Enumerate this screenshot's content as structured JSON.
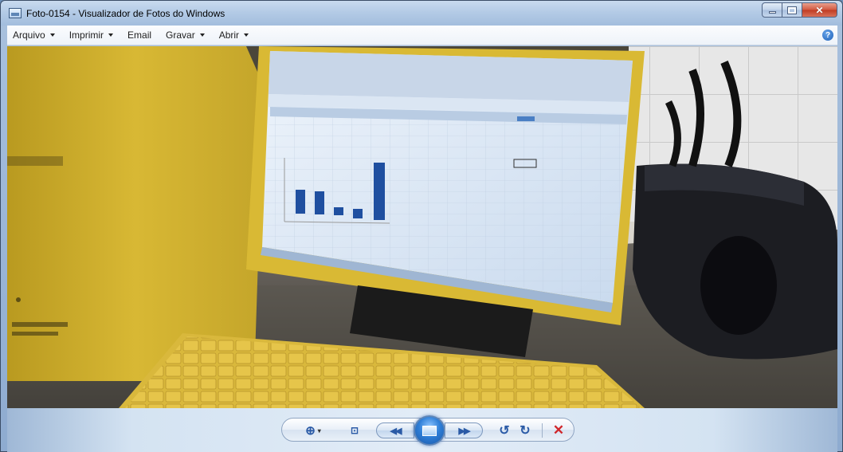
{
  "window": {
    "title": "Foto-0154 - Visualizador de Fotos do Windows",
    "icon": "photo-viewer-icon",
    "controls": {
      "minimize": "minimize-icon",
      "maximize": "maximize-icon",
      "close": "close-icon"
    }
  },
  "menu": {
    "items": [
      {
        "label": "Arquivo",
        "dropdown": true
      },
      {
        "label": "Imprimir",
        "dropdown": true
      },
      {
        "label": "Email",
        "dropdown": false
      },
      {
        "label": "Gravar",
        "dropdown": true
      },
      {
        "label": "Abrir",
        "dropdown": true
      }
    ],
    "help": "?"
  },
  "photo": {
    "subject": "computer-desk-photo",
    "colors": {
      "monitor": "#e8c84a",
      "screen": "#d8e6f5",
      "bars": "#1f4fa0",
      "wall": "#e6e6e6"
    }
  },
  "toolbar": {
    "zoom": {
      "icon": "zoom-icon",
      "glyph": "⊕",
      "caret": "▾"
    },
    "fit": {
      "icon": "actual-size-icon",
      "glyph": "⊡"
    },
    "previous": {
      "icon": "previous-icon",
      "glyph": "◀◀"
    },
    "slideshow": {
      "icon": "slideshow-icon"
    },
    "next": {
      "icon": "next-icon",
      "glyph": "▶▶"
    },
    "rotate_left": {
      "icon": "rotate-left-icon",
      "glyph": "↺"
    },
    "rotate_right": {
      "icon": "rotate-right-icon",
      "glyph": "↻"
    },
    "delete": {
      "icon": "delete-icon",
      "glyph": "✕"
    }
  }
}
